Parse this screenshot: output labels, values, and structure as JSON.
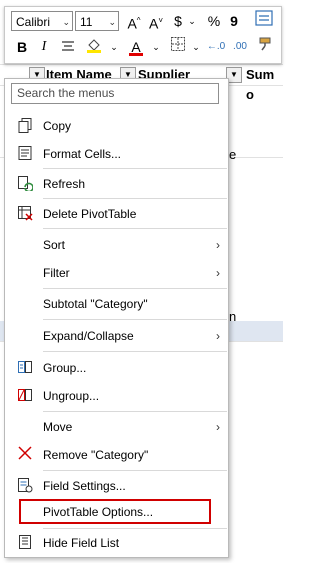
{
  "toolbar": {
    "font_name": "Calibri",
    "font_size": "11",
    "grow_label": "A^",
    "shrink_label": "A˅",
    "currency": "$",
    "percent": "%",
    "comma": "9",
    "bold": "B",
    "italic": "I",
    "font_color_letter": "A",
    "decrease_decimal": ".00",
    "increase_decimal": "0.0"
  },
  "sheet": {
    "headers": [
      "Item Name",
      "Supplier",
      "Sum o"
    ],
    "fragment_e": "e",
    "fragment_n": "n"
  },
  "menu": {
    "search_placeholder": "Search the menus",
    "items": [
      {
        "label": "Copy",
        "icon": "copy-icon"
      },
      {
        "label": "Format Cells...",
        "icon": "format-cells-icon"
      },
      {
        "label": "Refresh",
        "icon": "refresh-icon"
      },
      {
        "label": "Delete PivotTable",
        "icon": "delete-pivottable-icon"
      },
      {
        "label": "Sort",
        "submenu": "›"
      },
      {
        "label": "Filter",
        "submenu": "›"
      },
      {
        "label": "Subtotal \"Category\""
      },
      {
        "label": "Expand/Collapse",
        "submenu": "›"
      },
      {
        "label": "Group...",
        "icon": "group-icon"
      },
      {
        "label": "Ungroup...",
        "icon": "ungroup-icon"
      },
      {
        "label": "Move",
        "submenu": "›"
      },
      {
        "label": "Remove \"Category\"",
        "icon": "remove-x-icon"
      },
      {
        "label": "Field Settings...",
        "icon": "field-settings-icon"
      },
      {
        "label": "PivotTable Options...",
        "highlighted": true
      },
      {
        "label": "Hide Field List",
        "icon": "field-list-icon"
      }
    ]
  },
  "colors": {
    "highlight_box": "#d00000",
    "font_color_bar": "#e00000",
    "highlight_bar": "#ffe600",
    "selected_row": "#dfe6f1"
  }
}
